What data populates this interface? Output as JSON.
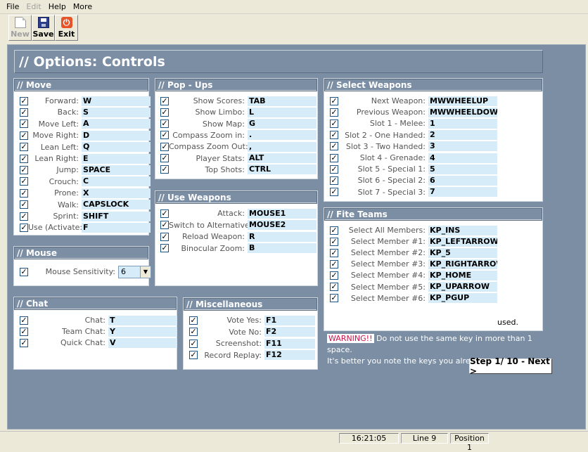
{
  "menu": [
    "File",
    "Edit",
    "Help",
    "More"
  ],
  "toolbar": {
    "new": "New",
    "save": "Save",
    "exit": "Exit"
  },
  "page_title": "// Options: Controls",
  "move": {
    "title": "// Move",
    "items": [
      {
        "label": "Forward:",
        "value": "W"
      },
      {
        "label": "Back:",
        "value": "S"
      },
      {
        "label": "Move Left:",
        "value": "A"
      },
      {
        "label": "Move Right:",
        "value": "D"
      },
      {
        "label": "Lean Left:",
        "value": "Q"
      },
      {
        "label": "Lean Right:",
        "value": "E"
      },
      {
        "label": "Jump:",
        "value": "SPACE"
      },
      {
        "label": "Crouch:",
        "value": "C"
      },
      {
        "label": "Prone:",
        "value": "X"
      },
      {
        "label": "Walk:",
        "value": "CAPSLOCK"
      },
      {
        "label": "Sprint:",
        "value": "SHIFT"
      },
      {
        "label": "Use (Activate:",
        "value": "F"
      }
    ]
  },
  "popups": {
    "title": "// Pop - Ups",
    "items": [
      {
        "label": "Show Scores:",
        "value": "TAB"
      },
      {
        "label": "Show Limbo:",
        "value": "L"
      },
      {
        "label": "Show Map:",
        "value": "G"
      },
      {
        "label": "Compass Zoom in:",
        "value": "."
      },
      {
        "label": "Compass Zoom Out:",
        "value": ","
      },
      {
        "label": "Player Stats:",
        "value": "ALT"
      },
      {
        "label": "Top Shots:",
        "value": "CTRL"
      }
    ]
  },
  "select_weapons": {
    "title": "// Select Weapons",
    "items": [
      {
        "label": "Next Weapon:",
        "value": "MWWHEELUP"
      },
      {
        "label": "Previous Weapon:",
        "value": "MWWHEELDOWN"
      },
      {
        "label": "Slot 1 - Melee:",
        "value": "1"
      },
      {
        "label": "Slot 2 - One Handed:",
        "value": "2"
      },
      {
        "label": "Slot 3 - Two Handed:",
        "value": "3"
      },
      {
        "label": "Slot 4 - Grenade:",
        "value": "4"
      },
      {
        "label": "Slot 5 - Special 1:",
        "value": "5"
      },
      {
        "label": "Slot 6 - Special 2:",
        "value": "6"
      },
      {
        "label": "Slot 7 - Special 3:",
        "value": "7"
      }
    ]
  },
  "use_weapons": {
    "title": "// Use Weapons",
    "items": [
      {
        "label": "Attack:",
        "value": "MOUSE1"
      },
      {
        "label": "Switch to Alternative:",
        "value": "MOUSE2"
      },
      {
        "label": "Reload Weapon:",
        "value": "R"
      },
      {
        "label": "Binocular Zoom:",
        "value": "B"
      }
    ]
  },
  "fire_teams": {
    "title": "// Fite Teams",
    "items": [
      {
        "label": "Select All Members:",
        "value": "KP_INS"
      },
      {
        "label": "Select Member #1:",
        "value": "KP_LEFTARROW"
      },
      {
        "label": "Select Member #2:",
        "value": "KP_5"
      },
      {
        "label": "Select Member #3:",
        "value": "KP_RIGHTARROW"
      },
      {
        "label": "Select Member #4:",
        "value": "KP_HOME"
      },
      {
        "label": "Select Member #5:",
        "value": "KP_UPARROW"
      },
      {
        "label": "Select Member #6:",
        "value": "KP_PGUP"
      }
    ],
    "used": "used."
  },
  "mouse": {
    "title": "// Mouse",
    "label": "Mouse Sensitivity:",
    "value": "6"
  },
  "chat": {
    "title": "// Chat",
    "items": [
      {
        "label": "Chat:",
        "value": "T"
      },
      {
        "label": "Team Chat:",
        "value": "Y"
      },
      {
        "label": "Quick Chat:",
        "value": "V"
      }
    ]
  },
  "misc": {
    "title": "// Miscellaneous",
    "items": [
      {
        "label": "Vote Yes:",
        "value": "F1"
      },
      {
        "label": "Vote No:",
        "value": "F2"
      },
      {
        "label": "Screenshot:",
        "value": "F11"
      },
      {
        "label": "Record Replay:",
        "value": "F12"
      }
    ]
  },
  "warning": {
    "tag": "WARNING!!",
    "line1": " Do not use the same key in more than 1 space.",
    "line2": "It's better you note the keys you already used."
  },
  "next_button": "Step 1/ 10 - Next >",
  "status": {
    "time": "16:21:05",
    "line": "Line 9",
    "position": "Position 1"
  }
}
